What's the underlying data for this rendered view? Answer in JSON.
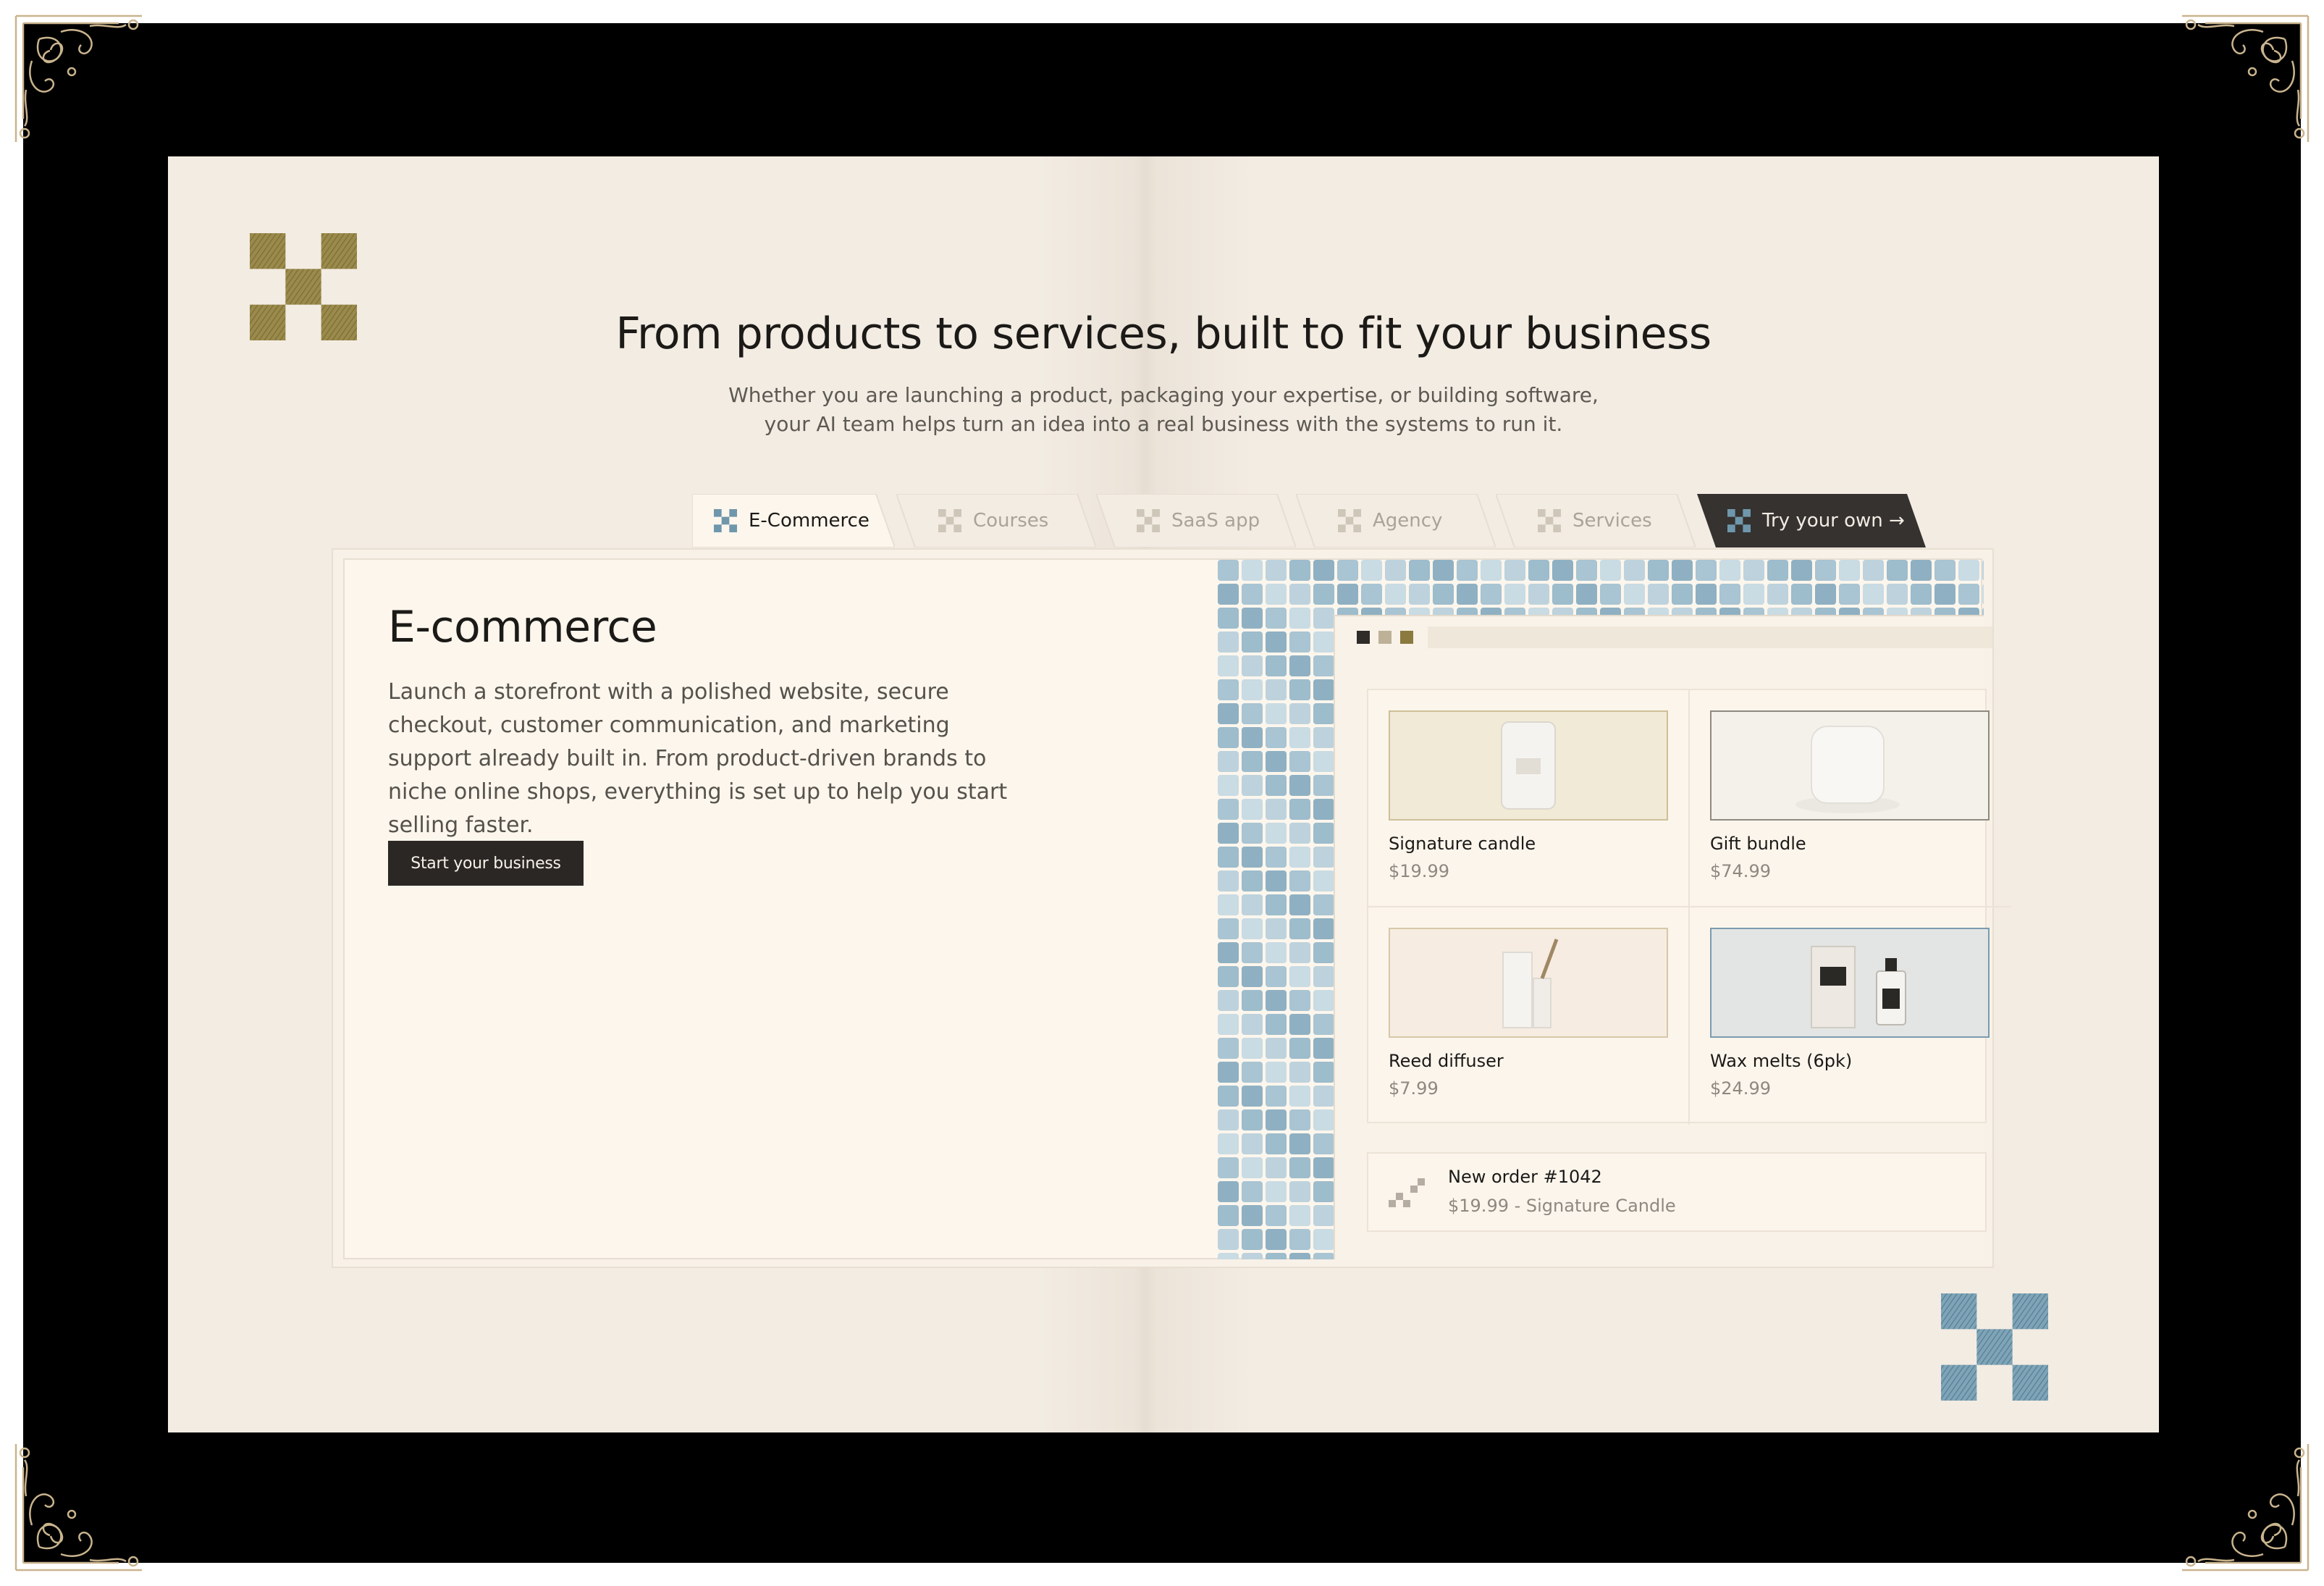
{
  "page": {
    "heading": "From products to services, built to fit your business",
    "subheading_line1": "Whether you are launching a product, packaging your expertise, or building software,",
    "subheading_line2": "your AI team helps turn an idea into a real business with the systems to run it."
  },
  "tabs": [
    {
      "label": "E-Commerce",
      "state": "active"
    },
    {
      "label": "Courses",
      "state": "inactive"
    },
    {
      "label": "SaaS app",
      "state": "inactive"
    },
    {
      "label": "Agency",
      "state": "inactive"
    },
    {
      "label": "Services",
      "state": "inactive"
    },
    {
      "label": "Try your own →",
      "state": "dark"
    }
  ],
  "panel": {
    "title": "E-commerce",
    "description": "Launch a storefront with a polished website, secure checkout, customer communication, and marketing support already built in. From product-driven brands to niche online shops, everything is set up to help you start selling faster.",
    "cta": "Start your business"
  },
  "store_mock": {
    "products": [
      {
        "name": "Signature candle",
        "price": "$19.99"
      },
      {
        "name": "Gift bundle",
        "price": "$74.99"
      },
      {
        "name": "Reed diffuser",
        "price": "$7.99"
      },
      {
        "name": "Wax melts (6pk)",
        "price": "$24.99"
      }
    ],
    "order": {
      "title": "New order #1042",
      "detail": "$19.99 - Signature Candle"
    }
  },
  "colors": {
    "frame": "#000000",
    "canvas": "#f3ece3",
    "gold": "#8a7a3e",
    "blue": "#6f97ab",
    "dark_button": "#2a2725",
    "ornament": "#c9b48e"
  },
  "icons": [
    "ornament-corner-icon",
    "checker-logo-icon",
    "checker-tab-icon",
    "order-dots-icon"
  ]
}
